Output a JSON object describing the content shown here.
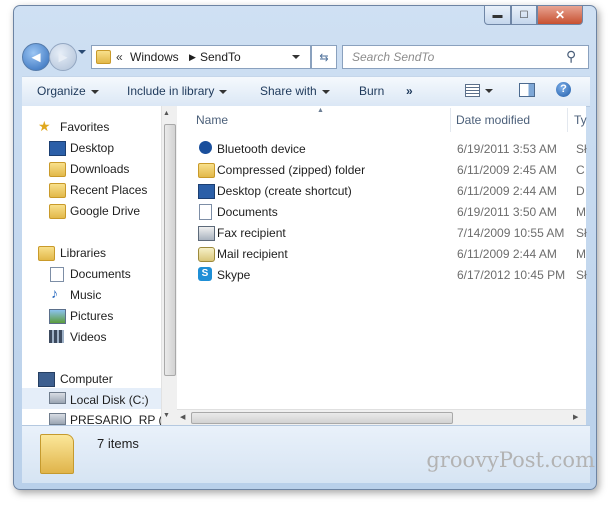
{
  "window": {
    "controls": {
      "minimize": "▬",
      "maximize": "☐",
      "close": "✕"
    }
  },
  "nav": {
    "back_label": "◄",
    "forward_label": "►",
    "breadcrumb_prefix": "«",
    "path": [
      "Windows",
      "SendTo"
    ],
    "search_placeholder": "Search SendTo"
  },
  "toolbar": {
    "organize": "Organize",
    "include_in_library": "Include in library",
    "share_with": "Share with",
    "burn": "Burn",
    "more": "»"
  },
  "sidebar": {
    "favorites_label": "Favorites",
    "favorites": [
      "Desktop",
      "Downloads",
      "Recent Places",
      "Google Drive"
    ],
    "libraries_label": "Libraries",
    "libraries": [
      "Documents",
      "Music",
      "Pictures",
      "Videos"
    ],
    "computer_label": "Computer",
    "drives": [
      "Local Disk (C:)",
      "PRESARIO_RP (D:"
    ]
  },
  "columns": {
    "name": "Name",
    "date_modified": "Date modified",
    "type": "Ty"
  },
  "files": [
    {
      "name": "Bluetooth device",
      "date": "6/19/2011 3:53 AM",
      "type": "Sł",
      "icon": "bluetooth-icon"
    },
    {
      "name": "Compressed (zipped) folder",
      "date": "6/11/2009 2:45 AM",
      "type": "C",
      "icon": "zip-folder-icon"
    },
    {
      "name": "Desktop (create shortcut)",
      "date": "6/11/2009 2:44 AM",
      "type": "D",
      "icon": "desktop-icon"
    },
    {
      "name": "Documents",
      "date": "6/19/2011 3:50 AM",
      "type": "M",
      "icon": "document-icon"
    },
    {
      "name": "Fax recipient",
      "date": "7/14/2009 10:55 AM",
      "type": "Sł",
      "icon": "fax-icon"
    },
    {
      "name": "Mail recipient",
      "date": "6/11/2009 2:44 AM",
      "type": "M",
      "icon": "mail-icon"
    },
    {
      "name": "Skype",
      "date": "6/17/2012 10:45 PM",
      "type": "Sł",
      "icon": "skype-icon"
    }
  ],
  "details": {
    "item_count": "7 items"
  },
  "watermark": "groovyPost.com",
  "colors": {
    "accent": "#2e6ab8",
    "frame": "#b9d0ea",
    "toolbar_text": "#1e395b"
  }
}
